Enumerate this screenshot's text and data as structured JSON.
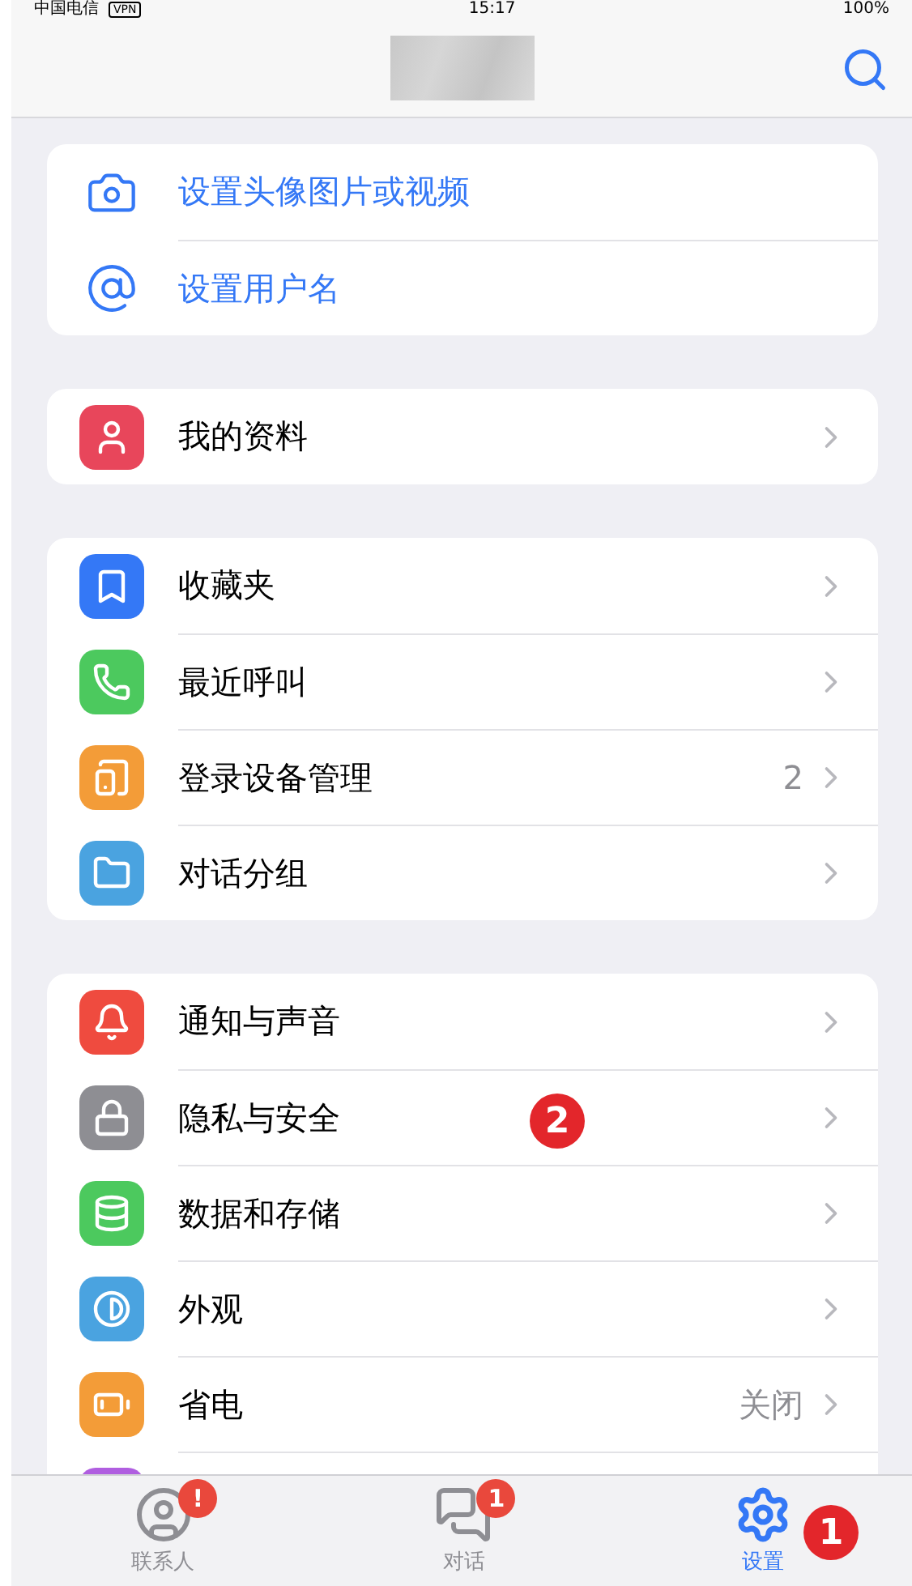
{
  "status_bar": {
    "carrier": "中国电信",
    "vpn": "VPN",
    "time": "15:17",
    "battery": "100%"
  },
  "profile_actions": [
    {
      "kind": "camera",
      "label": "设置头像图片或视频"
    },
    {
      "kind": "at",
      "label": "设置用户名"
    }
  ],
  "sections": [
    [
      {
        "kind": "person",
        "color": "#e8465b",
        "label": "我的资料"
      }
    ],
    [
      {
        "kind": "bookmark",
        "color": "#3478f6",
        "label": "收藏夹"
      },
      {
        "kind": "phone",
        "color": "#4cc95e",
        "label": "最近呼叫"
      },
      {
        "kind": "devices",
        "color": "#f39c38",
        "label": "登录设备管理",
        "value": "2"
      },
      {
        "kind": "folder",
        "color": "#4aa3e0",
        "label": "对话分组"
      }
    ],
    [
      {
        "kind": "bell",
        "color": "#ef4b3f",
        "label": "通知与声音"
      },
      {
        "kind": "lock",
        "color": "#8e8e93",
        "label": "隐私与安全"
      },
      {
        "kind": "database",
        "color": "#4cc95e",
        "label": "数据和存储"
      },
      {
        "kind": "contrast",
        "color": "#4aa3e0",
        "label": "外观"
      },
      {
        "kind": "battery",
        "color": "#f39c38",
        "label": "省电",
        "value": "关闭"
      },
      {
        "kind": "tile",
        "color": "#b05ee0"
      }
    ]
  ],
  "tabs": [
    {
      "kind": "person",
      "label": "联系人",
      "badge": "!",
      "selected": false
    },
    {
      "kind": "chat",
      "label": "对话",
      "badge": "1",
      "selected": false
    },
    {
      "kind": "gear",
      "label": "设置",
      "selected": true
    }
  ],
  "annotations": [
    {
      "text": "2"
    },
    {
      "text": "1"
    }
  ]
}
